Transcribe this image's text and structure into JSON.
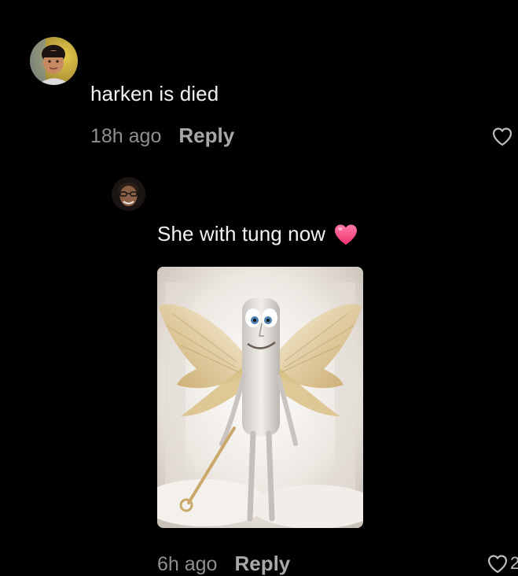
{
  "comments": [
    {
      "text": "harken is died",
      "time": "18h ago",
      "reply_label": "Reply",
      "avatar_icon": "user-avatar-boy-icon"
    }
  ],
  "replies": [
    {
      "text": "She with tung now",
      "emoji": "pink-heart-icon",
      "time": "6h ago",
      "reply_label": "Reply",
      "avatar_icon": "user-avatar-man-icon",
      "image": "winged-angel-meme-image",
      "like_count_partial": "2"
    }
  ],
  "colors": {
    "background": "#000000",
    "comment_text": "#f2f2f2",
    "time_text": "#8f8f8f",
    "reply_text": "#a8a8a8",
    "heart_emoji": "#ff4f8b"
  }
}
